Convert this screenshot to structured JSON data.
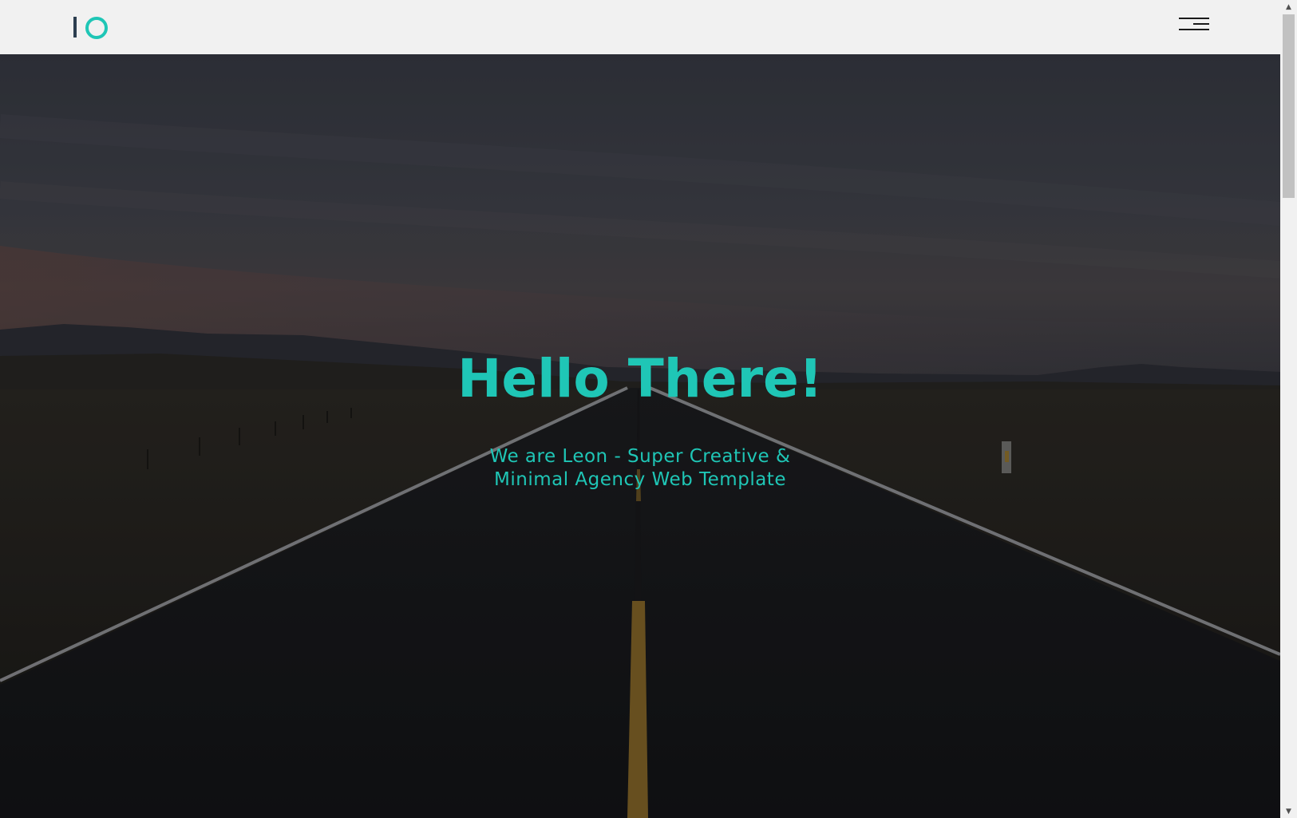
{
  "header": {
    "logo_alt": "IO logo",
    "menu_icon": "hamburger-menu-icon"
  },
  "hero": {
    "title": "Hello There!",
    "subtitle_line1": "We are Leon - Super Creative &",
    "subtitle_line2": "Minimal Agency Web Template",
    "background": "dark road landscape at dusk"
  },
  "colors": {
    "accent": "#1fc6b6",
    "logo_dark": "#2c3e50",
    "header_bg": "#f1f1f1"
  }
}
